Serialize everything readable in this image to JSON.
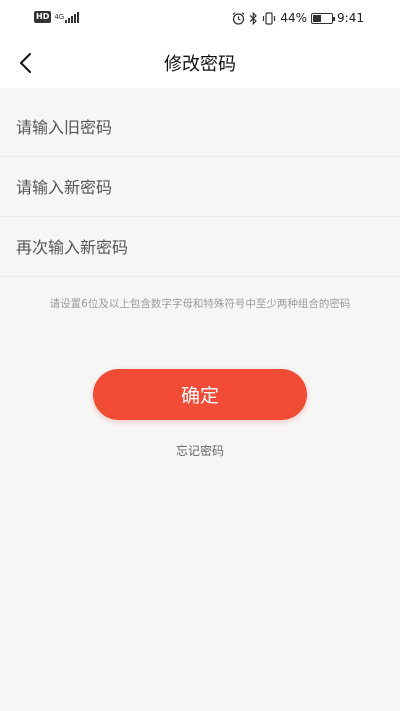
{
  "status_bar": {
    "hd_label": "HD",
    "network_label": "4G",
    "icons": [
      "alarm-icon",
      "bluetooth-icon",
      "vibrate-icon",
      "battery-icon"
    ],
    "battery_percent_text": "44%",
    "battery_level": 0.44,
    "time": "9:41"
  },
  "nav": {
    "back_icon": "chevron-left-icon",
    "title": "修改密码"
  },
  "form": {
    "old_password": {
      "value": "",
      "placeholder": "请输入旧密码"
    },
    "new_password": {
      "value": "",
      "placeholder": "请输入新密码"
    },
    "confirm_password": {
      "value": "",
      "placeholder": "再次输入新密码"
    },
    "hint": "请设置6位及以上包含数字字母和特殊符号中至少两种组合的密码"
  },
  "actions": {
    "confirm_label": "确定",
    "forgot_label": "忘记密码"
  },
  "colors": {
    "accent": "#f24b36",
    "background": "#f6f6f6",
    "header": "#ffffff"
  }
}
